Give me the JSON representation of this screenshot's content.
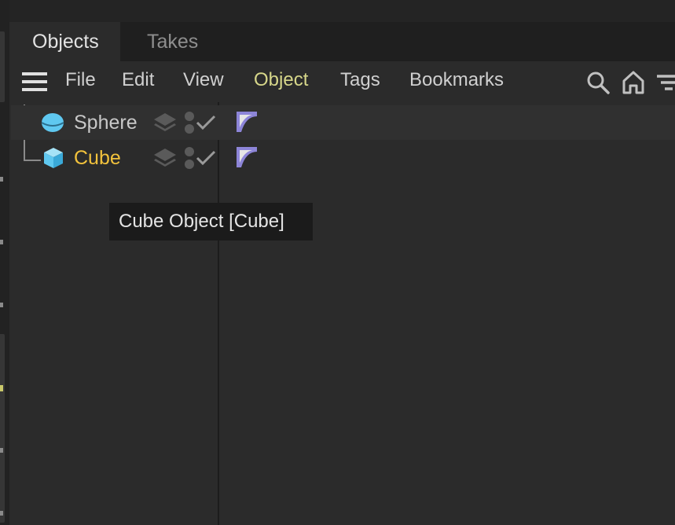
{
  "tabs": [
    {
      "label": "Objects",
      "active": true
    },
    {
      "label": "Takes",
      "active": false
    }
  ],
  "menu": {
    "items": [
      "File",
      "Edit",
      "View",
      "Object",
      "Tags",
      "Bookmarks"
    ],
    "highlighted": "Object"
  },
  "toolbar_icons": [
    "search-icon",
    "home-icon",
    "filter-icon"
  ],
  "objects": [
    {
      "name": "Sphere",
      "icon": "sphere-icon",
      "color": "#c8c8c8",
      "selected": false
    },
    {
      "name": "Cube",
      "icon": "cube-icon",
      "color": "#f2c23c",
      "selected": true
    }
  ],
  "tooltip": {
    "text": "Cube Object [Cube]"
  },
  "colors": {
    "background": "#2b2b2b",
    "highlight_menu": "#d7d78a",
    "selected_object": "#f2c23c",
    "object_icon": "#5fc8f0",
    "tag_icon": "#8d85d8"
  }
}
